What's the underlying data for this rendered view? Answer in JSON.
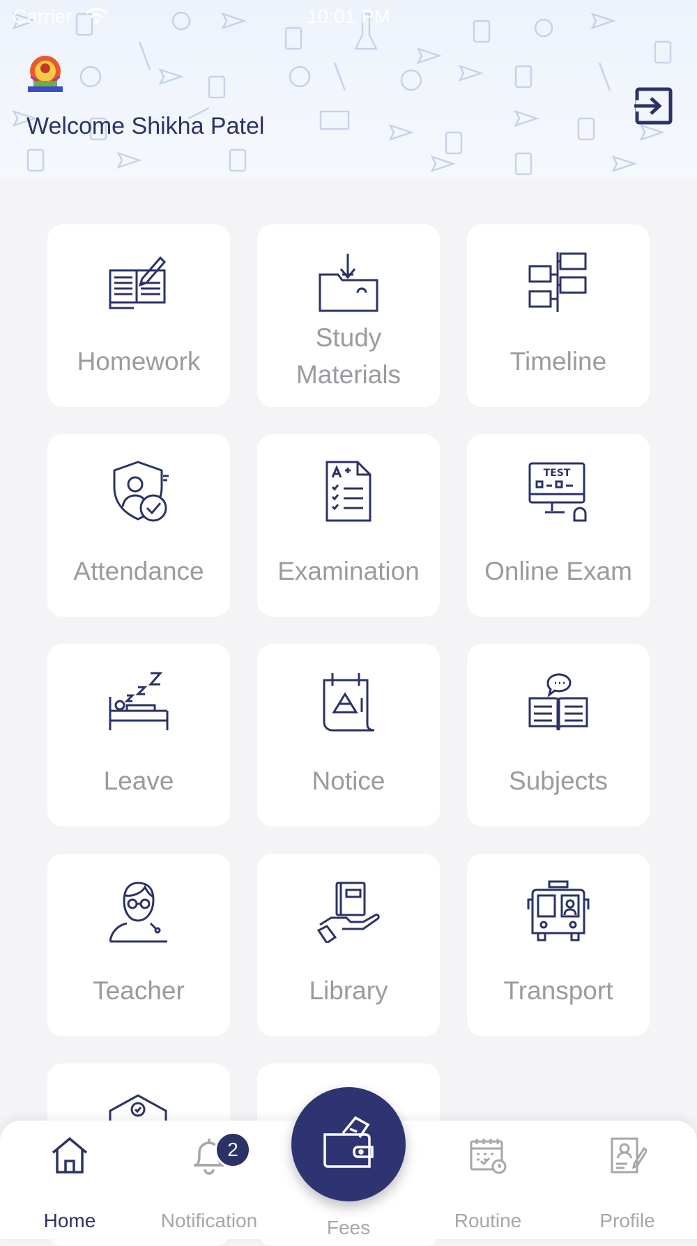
{
  "status_bar": {
    "carrier": "Carrier",
    "time": "10:01 PM"
  },
  "header": {
    "welcome": "Welcome Shikha Patel"
  },
  "menu": [
    {
      "label": "Homework",
      "icon": "homework-icon"
    },
    {
      "label": "Study\nMaterials",
      "icon": "study-materials-icon"
    },
    {
      "label": "Timeline",
      "icon": "timeline-icon"
    },
    {
      "label": "Attendance",
      "icon": "attendance-icon"
    },
    {
      "label": "Examination",
      "icon": "examination-icon"
    },
    {
      "label": "Online Exam",
      "icon": "online-exam-icon"
    },
    {
      "label": "Leave",
      "icon": "leave-icon"
    },
    {
      "label": "Notice",
      "icon": "notice-icon"
    },
    {
      "label": "Subjects",
      "icon": "subjects-icon"
    },
    {
      "label": "Teacher",
      "icon": "teacher-icon"
    },
    {
      "label": "Library",
      "icon": "library-icon"
    },
    {
      "label": "Transport",
      "icon": "transport-icon"
    }
  ],
  "tabbar": {
    "home": "Home",
    "notification": "Notification",
    "notification_badge": "2",
    "fees": "Fees",
    "routine": "Routine",
    "profile": "Profile"
  },
  "colors": {
    "primary": "#2b3266",
    "label_gray": "#9a9a9f",
    "background": "#f4f4f6"
  }
}
